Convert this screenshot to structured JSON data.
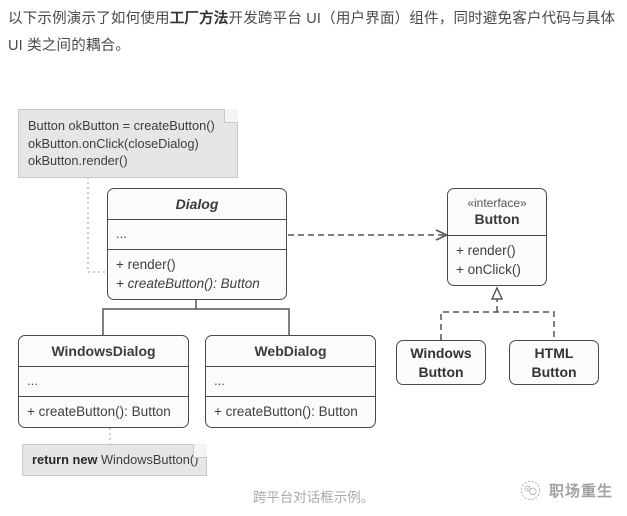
{
  "intro": {
    "part1": "以下示例演示了如何使用",
    "bold": "工厂方法",
    "part2": "开发跨平台 UI（用户界面）组件，同时避免客户代码与具体 UI 类之间的耦合。"
  },
  "diagram": {
    "client_note": {
      "name": "client-code-note",
      "lines": [
        "Button okButton = createButton()",
        "okButton.onClick(closeDialog)",
        "okButton.render()"
      ]
    },
    "dialog": {
      "title": "Dialog",
      "stereotype": "",
      "attributes": [
        "..."
      ],
      "operations": [
        {
          "text": "+ render()",
          "abstract": false
        },
        {
          "text": "+ createButton(): Button",
          "abstract": true
        }
      ]
    },
    "button_interface": {
      "stereotype": "«interface»",
      "title": "Button",
      "operations": [
        {
          "text": "+ render()",
          "abstract": false
        },
        {
          "text": "+ onClick()",
          "abstract": false
        }
      ]
    },
    "windows_dialog": {
      "title": "WindowsDialog",
      "attributes": [
        "..."
      ],
      "operations": [
        {
          "text": "+ createButton(): Button",
          "abstract": false
        }
      ]
    },
    "web_dialog": {
      "title": "WebDialog",
      "attributes": [
        "..."
      ],
      "operations": [
        {
          "text": "+ createButton(): Button",
          "abstract": false
        }
      ]
    },
    "windows_button": {
      "line1": "Windows",
      "line2": "Button"
    },
    "html_button": {
      "line1": "HTML",
      "line2": "Button"
    },
    "return_note": {
      "keyword": "return new",
      "rest": " WindowsButton()"
    }
  },
  "caption": "跨平台对话框示例。",
  "watermark": {
    "text": "职场重生",
    "logo_icon": "circular-badge-icon"
  },
  "colors": {
    "box_fill": "#fbfbfb",
    "box_border": "#4a4a4a",
    "note_fill": "#e6e6e6",
    "note_border": "#c8c8c8",
    "text": "#3a3a3a",
    "caption": "#a9a9a9",
    "line": "#555555"
  }
}
